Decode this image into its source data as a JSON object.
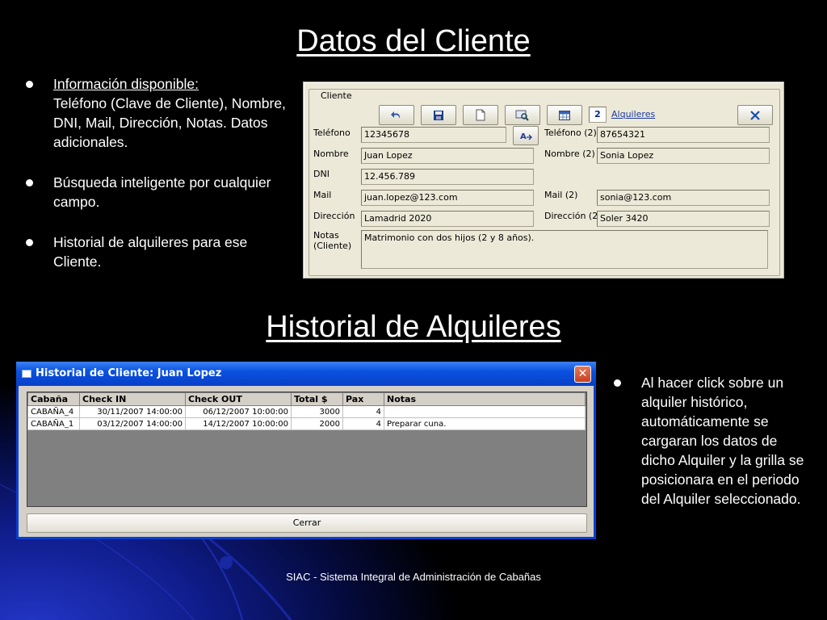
{
  "slide": {
    "title1": "Datos del Cliente",
    "title2": "Historial de Alquileres",
    "footer": "SIAC - Sistema Integral de Administración de Cabañas"
  },
  "left_bullets": [
    {
      "head": "Información disponible:",
      "body": "Teléfono (Clave de Cliente), Nombre, DNI, Mail, Dirección, Notas. Datos adicionales."
    },
    {
      "body": "Búsqueda inteligente por cualquier campo."
    },
    {
      "body": "Historial de alquileres para ese Cliente."
    }
  ],
  "right_bullet": "Al hacer click sobre un alquiler histórico, automáticamente se cargaran los datos de dicho Alquiler y la grilla se posicionara en el periodo del Alquiler seleccionado.",
  "client_form": {
    "group_label": "Cliente",
    "toolbar": {
      "count": "2",
      "alquileres_link": "Alquileres",
      "icons": [
        "undo-icon",
        "save-icon",
        "new-document-icon",
        "search-icon",
        "grid-icon",
        "close-icon"
      ]
    },
    "labels": {
      "telefono": "Teléfono",
      "nombre": "Nombre",
      "dni": "DNI",
      "mail": "Mail",
      "direccion": "Dirección",
      "notas": "Notas\n(Cliente)",
      "telefono2": "Teléfono (2)",
      "nombre2": "Nombre (2)",
      "mail2": "Mail (2)",
      "direccion2": "Dirección (2)"
    },
    "values": {
      "telefono": "12345678",
      "nombre": "Juan Lopez",
      "dni": "12.456.789",
      "mail": "juan.lopez@123.com",
      "direccion": "Lamadrid 2020",
      "notas": "Matrimonio con dos hijos (2 y 8 años).",
      "telefono2": "87654321",
      "nombre2": "Sonia Lopez",
      "mail2": "sonia@123.com",
      "direccion2": "Soler 3420"
    }
  },
  "history_window": {
    "title": "Historial de Cliente: Juan Lopez",
    "columns": [
      "Cabaña",
      "Check IN",
      "Check OUT",
      "Total $",
      "Pax",
      "Notas"
    ],
    "rows": [
      [
        "CABAÑA_4",
        "30/11/2007 14:00:00",
        "06/12/2007 10:00:00",
        "3000",
        "4",
        ""
      ],
      [
        "CABAÑA_1",
        "03/12/2007 14:00:00",
        "14/12/2007 10:00:00",
        "2000",
        "4",
        "Preparar cuna."
      ]
    ],
    "close_button": "Cerrar"
  },
  "colors": {
    "titlebar": "#0a52e0",
    "form_bg": "#ece9d8",
    "slide_bg": "#000000",
    "accent_blue": "#2336c8"
  }
}
